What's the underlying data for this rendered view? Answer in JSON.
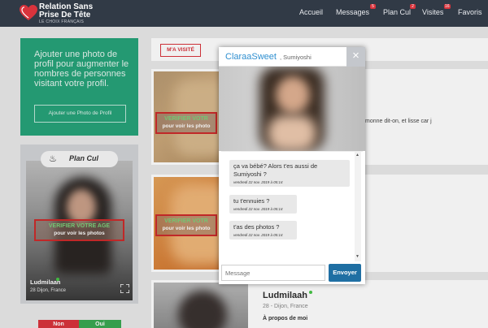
{
  "brand": {
    "line1": "Relation Sans",
    "line2": "Prise De Tête",
    "tagline": "LE CHOIX FRANÇAIS",
    "accent": "#d9333c"
  },
  "nav": {
    "items": [
      {
        "label": "Accueil",
        "badge": null
      },
      {
        "label": "Messages",
        "badge": "5"
      },
      {
        "label": "Plan Cul",
        "badge": "2"
      },
      {
        "label": "Visites",
        "badge": "16"
      },
      {
        "label": "Favoris",
        "badge": null
      }
    ]
  },
  "promo": {
    "text": "Ajouter une photo de profil pour augmenter le nombres de personnes visitant votre profil.",
    "button": "Ajouter une Photo de Profil"
  },
  "plan_cul_card": {
    "title": "Plan Cul",
    "verify_line1": "VERIFIER VOTRE AGE",
    "verify_line2": "pour voir les photos",
    "name": "Ludmilaah",
    "meta": "28 Dijon, France",
    "no_label": "Non",
    "yes_label": "Oui"
  },
  "feed": {
    "tab_label": "M'A VISITÉ",
    "cards": [
      {
        "verify_line1": "VERIFIER VOTR",
        "verify_line2": "pour voir les photo",
        "text": "monne dit-on, et lisse car j"
      },
      {
        "verify_line1": "VERIFIER VOTR",
        "verify_line2": "pour voir les photo"
      },
      {
        "name": "Ludmilaah",
        "meta": "28 - Dijon, France",
        "about": "À propos de moi"
      }
    ]
  },
  "chat": {
    "name": "ClaraaSweet",
    "city": ", Sumiyoshi",
    "close": "×",
    "messages": [
      {
        "text": "ça va bébé? Alors t'es aussi de Sumiyoshi ?",
        "time": "vendredi 22 nov. 2019 à 05:14"
      },
      {
        "text": "tu t'ennuies ?",
        "time": "vendredi 22 nov. 2019 à 05:14"
      },
      {
        "text": "t'as des photos ?",
        "time": "vendredi 22 nov. 2019 à 05:14"
      }
    ],
    "input_placeholder": "Message",
    "send_label": "Envoyer"
  },
  "icons": {
    "logo": "heart-logo-icon",
    "plan_cul": "flame-badge-icon",
    "expand": "expand-icon",
    "online": "online-dot-icon"
  }
}
